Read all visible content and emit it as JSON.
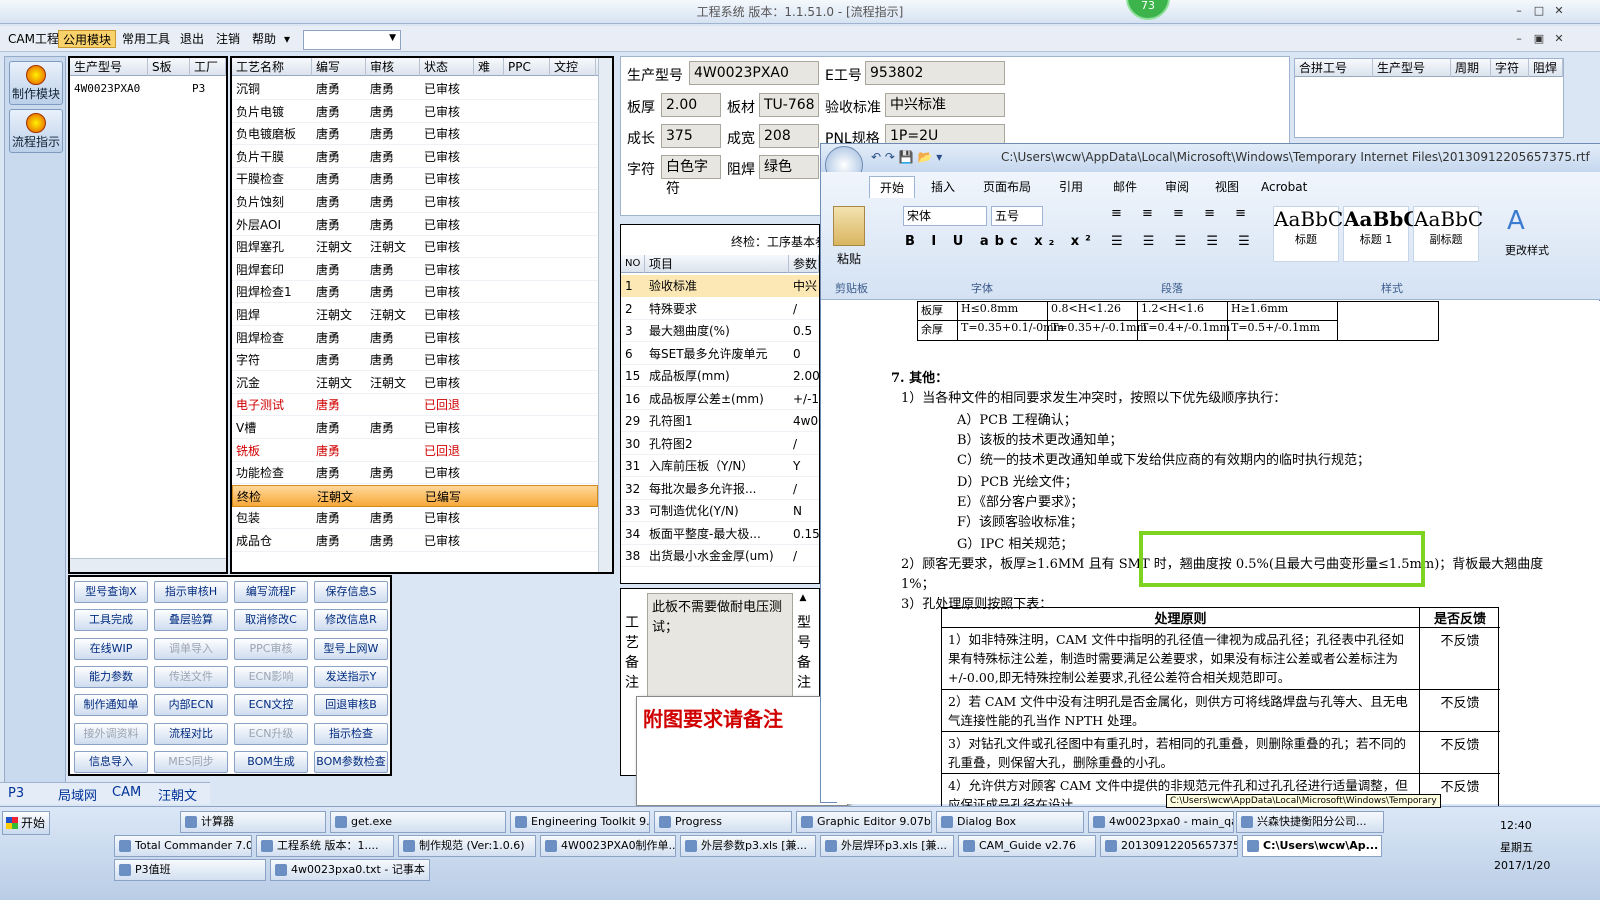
{
  "app": {
    "title": "工程系统  版本：1.1.51.0 - [流程指示]",
    "badge": "73"
  },
  "menu": {
    "items": [
      "CAM工程",
      "公用模块",
      "常用工具",
      "退出",
      "注销",
      "帮助"
    ],
    "help_arrow": "▾"
  },
  "nav": {
    "items": [
      "制作模块",
      "流程指示"
    ]
  },
  "model_list": {
    "headers": [
      "生产型号",
      "S板",
      "工厂"
    ],
    "rows": [
      [
        "4W0023PXA0",
        "",
        "P3"
      ]
    ]
  },
  "process": {
    "headers": [
      "工艺名称",
      "编写",
      "审核",
      "状态",
      "难",
      "PPC",
      "文控"
    ],
    "rows": [
      [
        "沉铜",
        "唐勇",
        "唐勇",
        "已审核"
      ],
      [
        "负片电镀",
        "唐勇",
        "唐勇",
        "已审核"
      ],
      [
        "负电镀磨板",
        "唐勇",
        "唐勇",
        "已审核"
      ],
      [
        "负片干膜",
        "唐勇",
        "唐勇",
        "已审核"
      ],
      [
        "干膜检查",
        "唐勇",
        "唐勇",
        "已审核"
      ],
      [
        "负片蚀刻",
        "唐勇",
        "唐勇",
        "已审核"
      ],
      [
        "外层AOI",
        "唐勇",
        "唐勇",
        "已审核"
      ],
      [
        "阻焊塞孔",
        "汪朝文",
        "汪朝文",
        "已审核"
      ],
      [
        "阻焊套印",
        "唐勇",
        "唐勇",
        "已审核"
      ],
      [
        "阻焊检查1",
        "唐勇",
        "唐勇",
        "已审核"
      ],
      [
        "阻焊",
        "汪朝文",
        "汪朝文",
        "已审核"
      ],
      [
        "阻焊检查",
        "唐勇",
        "唐勇",
        "已审核"
      ],
      [
        "字符",
        "唐勇",
        "唐勇",
        "已审核"
      ],
      [
        "沉金",
        "汪朝文",
        "汪朝文",
        "已审核"
      ],
      [
        "电子测试",
        "唐勇",
        "",
        "已回退"
      ],
      [
        "V槽",
        "唐勇",
        "唐勇",
        "已审核"
      ],
      [
        "铣板",
        "唐勇",
        "",
        "已回退"
      ],
      [
        "功能检查",
        "唐勇",
        "唐勇",
        "已审核"
      ],
      [
        "终检",
        "汪朝文",
        "",
        "已编写"
      ],
      [
        "包装",
        "唐勇",
        "唐勇",
        "已审核"
      ],
      [
        "成品仓",
        "唐勇",
        "唐勇",
        "已审核"
      ]
    ]
  },
  "buttons": [
    "型号查询X",
    "指示审核H",
    "编写流程F",
    "保存信息S",
    "工具完成",
    "叠层验算",
    "取消修改C",
    "修改信息R",
    "在线WIP",
    "调单导入",
    "PPC审核",
    "型号上网W",
    "能力参数",
    "传送文件",
    "ECN影响",
    "发送指示Y",
    "制作通知单",
    "内部ECN",
    "ECN文控",
    "回退审核B",
    "接外调资料",
    "流程对比",
    "ECN升级",
    "指示检查",
    "信息导入",
    "MES同步",
    "BOM生成",
    "BOM参数检查"
  ],
  "info": {
    "labels": [
      "生产型号",
      "E工号",
      "板厚",
      "板材",
      "验收标准",
      "成长",
      "成宽",
      "PNL规格",
      "字符",
      "阻焊"
    ],
    "values": [
      "4W0023PXA0",
      "953802",
      "2.00",
      "TU-768",
      "中兴标准",
      "375",
      "208",
      "1P=2U",
      "白色字符",
      "绿色"
    ]
  },
  "merge": {
    "headers": [
      "合拼工号",
      "生产型号",
      "周期",
      "字符",
      "阻焊"
    ]
  },
  "final_check": {
    "title": "终检：工序基本参",
    "headers": [
      "NO",
      "项目",
      "参数"
    ],
    "rows": [
      [
        "1",
        "验收标准",
        "中兴"
      ],
      [
        "2",
        "特殊要求",
        "/"
      ],
      [
        "3",
        "最大翘曲度(%)",
        "0.5"
      ],
      [
        "6",
        "每SET最多允许废单元",
        "0"
      ],
      [
        "15",
        "成品板厚(mm)",
        "2.00"
      ],
      [
        "16",
        "成品板厚公差±(mm)",
        "+/-1"
      ],
      [
        "29",
        "孔符图1",
        "4w00"
      ],
      [
        "30",
        "孔符图2",
        "/"
      ],
      [
        "31",
        "入库前压板（Y/N）",
        "Y"
      ],
      [
        "32",
        "每批次最多允许报...",
        "/"
      ],
      [
        "33",
        "可制造优化(Y/N)",
        "N"
      ],
      [
        "34",
        "板面平整度-最大极...",
        "0.15"
      ],
      [
        "38",
        "出货最小水金金厚(um)",
        "/"
      ]
    ]
  },
  "remarks": {
    "label": "工艺备注",
    "text": "此板不需要做耐电压测试；",
    "label2": "型号备注",
    "attach": "附图要求请备注"
  },
  "status": {
    "site": "P3",
    "tabs": [
      "局域网",
      "CAM",
      "汪朝文"
    ]
  },
  "word": {
    "path": "C:\\Users\\wcw\\AppData\\Local\\Microsoft\\Windows\\Temporary Internet Files\\20130912205657375.rtf",
    "tabs": [
      "开始",
      "插入",
      "页面布局",
      "引用",
      "邮件",
      "审阅",
      "视图",
      "Acrobat"
    ],
    "font": "宋体",
    "size": "五号",
    "groups": [
      "剪贴板",
      "字体",
      "段落",
      "样式"
    ],
    "paste": "粘贴",
    "styles": [
      "标题",
      "标题 1",
      "副标题"
    ],
    "style_sample": "AaBbC",
    "change_style": "更改样式",
    "table_top": [
      "板厚",
      "H≤0.8mm",
      "0.8<H<1.26",
      "1.2<H<1.6",
      "H≥1.6mm",
      "余厚",
      "T=0.35+0.1/-0mm",
      "T=0.35+/-0.1mm",
      "T=0.4+/-0.1mm",
      "T=0.5+/-0.1mm"
    ],
    "lines": [
      "7.  其他：",
      "1）当各种文件的相同要求发生冲突时，按照以下优先级顺序执行：",
      "A）PCB 工程确认；",
      "B）该板的技术更改通知单；",
      "C）统一的技术更改通知单或下发给供应商的有效期内的临时执行规范；",
      "D）PCB 光绘文件；",
      "E）《部分客户要求》；",
      "F）该顾客验收标准；",
      "G）IPC 相关规范；",
      "2）顾客无要求，板厚≥1.6MM 且有 SMT 时，翘曲度按 0.5%(且最大弓曲变形量≤1.5mm)；背板最大翘曲度",
      "1%；",
      "3）孔处理原则按照下表："
    ],
    "table2_head": [
      "处理原则",
      "是否反馈"
    ],
    "table2": [
      [
        "1）如非特殊注明，CAM 文件中指明的孔径值一律视为成品孔径；孔径表中孔径如果有特殊标注公差，制造时需要满足公差要求，如果没有标注公差或者公差标注为+/-0.00,即无特殊控制公差要求,孔径公差符合相关规范即可。",
        "不反馈"
      ],
      [
        "2）若 CAM 文件中没有注明孔是否金属化，则供方可将线路焊盘与孔等大、且无电气连接性能的孔当作 NPTH 处理。",
        "不反馈"
      ],
      [
        "3）对钻孔文件或孔径图中有重孔时，若相同的孔重叠，则删除重叠的孔；若不同的孔重叠，则保留大孔，删除重叠的小孔。",
        "不反馈"
      ],
      [
        "4）允许供方对顾客 CAM 文件中提供的非规范元件孔和过孔孔径进行适量调整，但应保证成品孔径在设计",
        "不反馈"
      ]
    ],
    "tooltip": "C:\\Users\\wcw\\AppData\\Local\\Microsoft\\Windows\\Temporary"
  },
  "taskbar": {
    "start": "开始",
    "row1": [
      "计算器",
      "get.exe",
      "Engineering Toolkit 9....",
      "Progress",
      "Graphic Editor 9.07b2 ...",
      "Dialog Box",
      "4w0023pxa0 - main_qa",
      "兴森快捷衡阳分公司..."
    ],
    "row2": [
      "Total Commander 7.0...",
      "工程系统  版本：1....",
      "制作规范 (Ver:1.0.6)",
      "4W0023PXA0制作单...",
      "外层参数p3.xls [兼...",
      "外层焊环p3.xls [兼...",
      "CAM_Guide v2.76",
      "20130912205657375...",
      "C:\\Users\\wcw\\Ap..."
    ],
    "row3": [
      "P3值班",
      "4w0023pxa0.txt - 记事本"
    ],
    "time": "12:40",
    "weekday": "星期五",
    "date": "2017/1/20"
  }
}
